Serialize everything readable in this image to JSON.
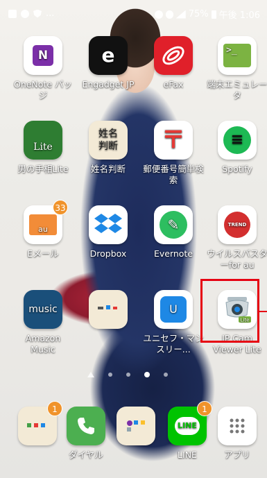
{
  "status_bar": {
    "left_icons": [
      "sim-icon",
      "cloud-icon",
      "shield-icon"
    ],
    "ellipsis": "...",
    "battery": "75%",
    "time": "午後 1:06"
  },
  "apps": [
    {
      "label": "OneNote バッジ",
      "icon_text": "N",
      "icon": "onenote-icon",
      "color": "#7b2fa8"
    },
    {
      "label": "Engadget JP",
      "icon_text": "e",
      "icon": "engadget-icon",
      "color": "#111111"
    },
    {
      "label": "eFax",
      "icon_text": "",
      "icon": "efax-icon",
      "color": "#e0202a"
    },
    {
      "label": "端末エミュレータ",
      "icon_text": ">_",
      "icon": "terminal-icon",
      "color": "#7cb342"
    },
    {
      "label": "男の手相Lite",
      "icon_text": "Lite",
      "icon": "palm-icon",
      "color": "#2e7d32"
    },
    {
      "label": "姓名判断",
      "icon_text": "姓名判断",
      "icon": "seimei-icon",
      "color": "#f3ead6"
    },
    {
      "label": "郵便番号簡単検索",
      "icon_text": "〒",
      "icon": "postal-icon",
      "color": "#e53935"
    },
    {
      "label": "Spotify",
      "icon_text": "≡",
      "icon": "spotify-icon",
      "color": "#1db954"
    },
    {
      "label": "Eメール",
      "icon_text": "au",
      "icon": "email-icon",
      "color": "#f28c38",
      "badge": "33"
    },
    {
      "label": "Dropbox",
      "icon_text": "◆",
      "icon": "dropbox-icon",
      "color": "#1e88e5"
    },
    {
      "label": "Evernote",
      "icon_text": "✎",
      "icon": "evernote-icon",
      "color": "#2dbe60"
    },
    {
      "label": "ウイルスバスターfor au",
      "icon_text": "TREND",
      "icon": "trend-icon",
      "color": "#d32f2f"
    },
    {
      "label": "Amazon Music",
      "icon_text": "music",
      "icon": "amazon-music-icon",
      "color": "#1a4f7a"
    },
    {
      "label": "",
      "icon_text": "",
      "icon": "folder-icon",
      "color": "#f3ead6"
    },
    {
      "label": "ユニセフ・マンスリー...",
      "icon_text": "U",
      "icon": "unicef-icon",
      "color": "#1e88e5"
    },
    {
      "label": "IP Cam Viewer Lite",
      "icon_text": "Lite",
      "icon": "ipcam-icon",
      "color": "#cfd8dc"
    }
  ],
  "dock": [
    {
      "label": "",
      "icon": "folder-icon",
      "badge": "1"
    },
    {
      "label": "ダイヤル",
      "icon": "phone-icon"
    },
    {
      "label": "",
      "icon": "folder-icon"
    },
    {
      "label": "LINE",
      "icon": "line-icon",
      "badge": "1"
    },
    {
      "label": "アプリ",
      "icon": "apps-grid-icon"
    }
  ],
  "page_indicator": {
    "pages": 5,
    "active": 3
  },
  "highlight_color": "#e60012"
}
